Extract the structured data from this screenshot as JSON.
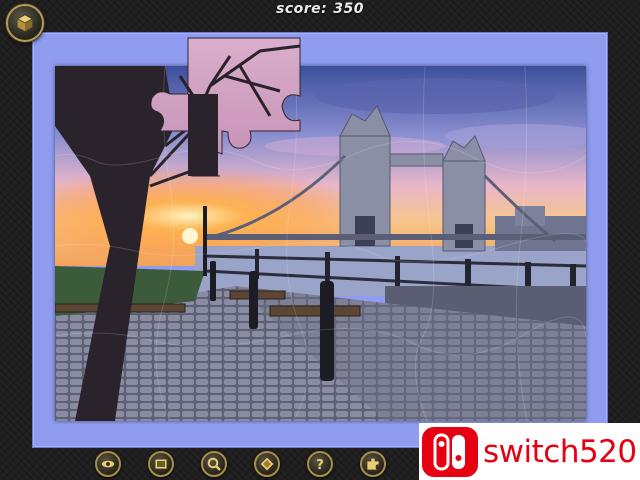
{
  "hud": {
    "score_label": "score:",
    "score_value": "350"
  },
  "menu_button": {
    "icon": "cube-menu-icon"
  },
  "puzzle": {
    "board_color": "#8f9cf0",
    "scene": "Tower Bridge at sunset",
    "loose_piece_visible": true
  },
  "toolbar": {
    "buttons": [
      {
        "icon": "eye-icon"
      },
      {
        "icon": "picture-icon"
      },
      {
        "icon": "magnifier-icon"
      },
      {
        "icon": "shapes-icon"
      },
      {
        "icon": "help-icon"
      },
      {
        "icon": "puzzle-piece-icon"
      }
    ]
  },
  "watermark": {
    "text": "switch520",
    "color": "#e60012"
  }
}
